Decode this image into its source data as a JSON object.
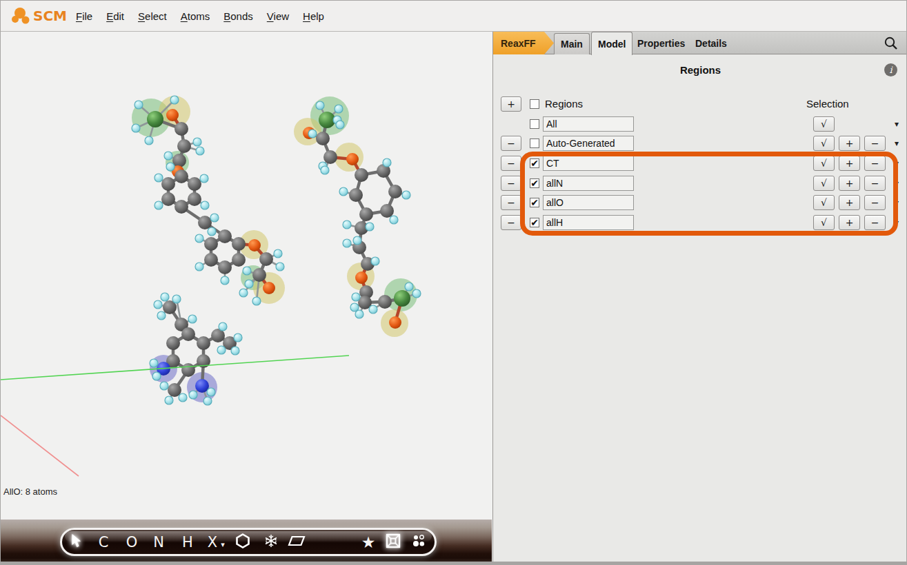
{
  "menubar": {
    "logo_text": "SCM",
    "items": [
      {
        "accel": "F",
        "rest": "ile"
      },
      {
        "accel": "E",
        "rest": "dit"
      },
      {
        "accel": "S",
        "rest": "elect"
      },
      {
        "accel": "A",
        "rest": "toms"
      },
      {
        "accel": "B",
        "rest": "onds"
      },
      {
        "accel": "V",
        "rest": "iew"
      },
      {
        "accel": "H",
        "rest": "elp"
      }
    ]
  },
  "viewport": {
    "status_text": "AllO: 8 atoms",
    "toolbar": {
      "c": "C",
      "o": "O",
      "n": "N",
      "h": "H",
      "x": "X",
      "star": "★",
      "x_arrow": "▾"
    }
  },
  "panel": {
    "tabs": {
      "reaxff": "ReaxFF",
      "main": "Main",
      "model": "Model",
      "properties": "Properties",
      "details": "Details"
    },
    "title": "Regions",
    "header": {
      "add": "+",
      "label": "Regions",
      "selection": "Selection"
    },
    "btn_check": "√",
    "btn_add": "+",
    "btn_remove": "−",
    "arrow_glyph": "▾",
    "rows": [
      {
        "name": "All",
        "check": ""
      },
      {
        "name": "Auto-Generated",
        "check": ""
      },
      {
        "name": "CT",
        "check": "✔"
      },
      {
        "name": "allN",
        "check": "✔"
      },
      {
        "name": "allO",
        "check": "✔"
      },
      {
        "name": "allH",
        "check": "✔"
      }
    ]
  },
  "scene": {
    "molecules": [
      {
        "halos": [
          [
            "g",
            218,
            125,
            28
          ],
          [
            "y",
            252,
            116,
            23
          ],
          [
            "g",
            256,
            190,
            17
          ],
          [
            "y",
            367,
            309,
            21
          ],
          [
            "g",
            366,
            357,
            18
          ],
          [
            "y",
            389,
            372,
            23
          ]
        ],
        "atoms": [
          [
            "G",
            224,
            127
          ],
          [
            "O",
            249,
            121
          ],
          [
            "C",
            262,
            141
          ],
          [
            "C",
            266,
            166
          ],
          [
            "C",
            259,
            187
          ],
          [
            "O",
            257,
            203
          ],
          [
            "C",
            262,
            210
          ],
          [
            "C",
            281,
            221
          ],
          [
            "C",
            281,
            243
          ],
          [
            "C",
            262,
            254
          ],
          [
            "C",
            243,
            243
          ],
          [
            "C",
            243,
            221
          ],
          [
            "C",
            296,
            277
          ],
          [
            "C",
            325,
            297
          ],
          [
            "C",
            345,
            308
          ],
          [
            "C",
            345,
            331
          ],
          [
            "C",
            325,
            342
          ],
          [
            "C",
            305,
            331
          ],
          [
            "C",
            305,
            308
          ],
          [
            "O",
            368,
            310
          ],
          [
            "C",
            385,
            330
          ],
          [
            "C",
            375,
            353
          ],
          [
            "O",
            389,
            372
          ],
          [
            "H",
            200,
            106
          ],
          [
            "H",
            196,
            140
          ],
          [
            "H",
            215,
            158
          ],
          [
            "H",
            252,
            99
          ],
          [
            "H",
            285,
            160
          ],
          [
            "H",
            289,
            173
          ],
          [
            "H",
            243,
            180
          ],
          [
            "H",
            246,
            196
          ],
          [
            "H",
            229,
            252
          ],
          [
            "H",
            229,
            212
          ],
          [
            "H",
            295,
            213
          ],
          [
            "H",
            296,
            252
          ],
          [
            "H",
            310,
            270
          ],
          [
            "H",
            306,
            290
          ],
          [
            "H",
            288,
            341
          ],
          [
            "H",
            325,
            361
          ],
          [
            "H",
            288,
            300
          ],
          [
            "H",
            402,
            322
          ],
          [
            "H",
            405,
            341
          ],
          [
            "H",
            357,
            347
          ],
          [
            "H",
            360,
            366
          ],
          [
            "H",
            371,
            391
          ],
          [
            "H",
            352,
            379
          ]
        ],
        "bonds": [
          [
            0,
            2
          ],
          [
            1,
            2,
            1
          ],
          [
            2,
            3
          ],
          [
            3,
            4
          ],
          [
            4,
            5,
            1
          ],
          [
            5,
            6,
            1
          ],
          [
            6,
            7
          ],
          [
            7,
            8
          ],
          [
            8,
            9
          ],
          [
            9,
            10
          ],
          [
            10,
            11
          ],
          [
            11,
            6
          ],
          [
            9,
            12
          ],
          [
            12,
            13
          ],
          [
            13,
            14
          ],
          [
            14,
            15
          ],
          [
            15,
            16
          ],
          [
            16,
            17
          ],
          [
            17,
            18
          ],
          [
            18,
            13
          ],
          [
            14,
            19,
            1
          ],
          [
            19,
            20,
            1
          ],
          [
            20,
            21
          ],
          [
            21,
            22,
            1
          ],
          [
            23,
            0
          ],
          [
            24,
            0
          ],
          [
            25,
            0
          ],
          [
            26,
            0
          ],
          [
            27,
            3
          ],
          [
            28,
            3
          ],
          [
            29,
            4
          ],
          [
            30,
            4
          ],
          [
            31,
            10
          ],
          [
            32,
            11
          ],
          [
            33,
            7
          ],
          [
            34,
            8
          ],
          [
            35,
            12
          ],
          [
            36,
            12
          ],
          [
            37,
            17
          ],
          [
            38,
            16
          ],
          [
            39,
            18
          ],
          [
            40,
            20
          ],
          [
            41,
            20
          ],
          [
            42,
            21
          ],
          [
            43,
            21
          ],
          [
            44,
            21
          ],
          [
            45,
            21
          ]
        ]
      },
      {
        "halos": [
          [
            "g",
            477,
            122,
            28
          ],
          [
            "y",
            445,
            145,
            20
          ],
          [
            "y",
            505,
            182,
            21
          ],
          [
            "y",
            522,
            355,
            20
          ],
          [
            "g",
            580,
            382,
            24
          ],
          [
            "y",
            571,
            423,
            20
          ]
        ],
        "atoms": [
          [
            "G",
            473,
            128
          ],
          [
            "O",
            447,
            147
          ],
          [
            "C",
            467,
            155
          ],
          [
            "C",
            478,
            182
          ],
          [
            "O",
            510,
            185
          ],
          [
            "C",
            523,
            208
          ],
          [
            "C",
            555,
            202
          ],
          [
            "C",
            572,
            232
          ],
          [
            "C",
            560,
            260
          ],
          [
            "C",
            530,
            265
          ],
          [
            "C",
            515,
            237
          ],
          [
            "C",
            523,
            285
          ],
          [
            "C",
            520,
            313
          ],
          [
            "C",
            532,
            337
          ],
          [
            "O",
            523,
            357
          ],
          [
            "C",
            530,
            378
          ],
          [
            "C",
            528,
            393
          ],
          [
            "C",
            557,
            392
          ],
          [
            "G",
            582,
            387
          ],
          [
            "O",
            572,
            422
          ],
          [
            "H",
            463,
            107
          ],
          [
            "H",
            488,
            128
          ],
          [
            "H",
            492,
            135
          ],
          [
            "H",
            452,
            148
          ],
          [
            "H",
            490,
            112
          ],
          [
            "H",
            467,
            195
          ],
          [
            "H",
            470,
            201
          ],
          [
            "H",
            560,
            190
          ],
          [
            "H",
            588,
            237
          ],
          [
            "H",
            497,
            232
          ],
          [
            "H",
            570,
            273
          ],
          [
            "H",
            502,
            280
          ],
          [
            "H",
            535,
            283
          ],
          [
            "H",
            502,
            307
          ],
          [
            "H",
            517,
            303
          ],
          [
            "H",
            543,
            333
          ],
          [
            "H",
            515,
            385
          ],
          [
            "H",
            513,
            400
          ],
          [
            "H",
            520,
            410
          ],
          [
            "H",
            540,
            403
          ],
          [
            "H",
            603,
            380
          ],
          [
            "H",
            592,
            370
          ]
        ],
        "bonds": [
          [
            0,
            2
          ],
          [
            1,
            2,
            1
          ],
          [
            2,
            3
          ],
          [
            3,
            4,
            1
          ],
          [
            4,
            5,
            1
          ],
          [
            5,
            6
          ],
          [
            6,
            7
          ],
          [
            7,
            8
          ],
          [
            8,
            9
          ],
          [
            9,
            10
          ],
          [
            10,
            5
          ],
          [
            9,
            11
          ],
          [
            11,
            12
          ],
          [
            12,
            13
          ],
          [
            13,
            14,
            1
          ],
          [
            14,
            15,
            1
          ],
          [
            15,
            16
          ],
          [
            16,
            17
          ],
          [
            17,
            18
          ],
          [
            18,
            19,
            1
          ],
          [
            20,
            0
          ],
          [
            21,
            0
          ],
          [
            22,
            0
          ],
          [
            23,
            2
          ],
          [
            24,
            0
          ],
          [
            25,
            3
          ],
          [
            26,
            3
          ],
          [
            27,
            6
          ],
          [
            28,
            7
          ],
          [
            29,
            10
          ],
          [
            30,
            8
          ],
          [
            31,
            11
          ],
          [
            32,
            11
          ],
          [
            33,
            12
          ],
          [
            34,
            12
          ],
          [
            35,
            13
          ],
          [
            36,
            16
          ],
          [
            37,
            16
          ],
          [
            38,
            16
          ],
          [
            39,
            17
          ],
          [
            40,
            18
          ],
          [
            41,
            18
          ]
        ]
      },
      {
        "halos": [
          [
            "b",
            236,
            489,
            20
          ],
          [
            "b",
            292,
            516,
            22
          ]
        ],
        "atoms": [
          [
            "C",
            245,
            400
          ],
          [
            "C",
            262,
            425
          ],
          [
            "C",
            272,
            439
          ],
          [
            "C",
            294,
            452
          ],
          [
            "C",
            294,
            478
          ],
          [
            "C",
            272,
            491
          ],
          [
            "C",
            250,
            478
          ],
          [
            "C",
            250,
            452
          ],
          [
            "N",
            236,
            489
          ],
          [
            "N",
            292,
            514
          ],
          [
            "C",
            315,
            441
          ],
          [
            "C",
            332,
            452
          ],
          [
            "C",
            252,
            520
          ],
          [
            "H",
            238,
            385
          ],
          [
            "H",
            228,
            396
          ],
          [
            "H",
            233,
            412
          ],
          [
            "H",
            255,
            388
          ],
          [
            "H",
            278,
            417
          ],
          [
            "H",
            222,
            481
          ],
          [
            "H",
            226,
            500
          ],
          [
            "H",
            279,
            527
          ],
          [
            "H",
            305,
            523
          ],
          [
            "H",
            300,
            536
          ],
          [
            "H",
            322,
            428
          ],
          [
            "H",
            344,
            444
          ],
          [
            "H",
            340,
            463
          ],
          [
            "H",
            320,
            462
          ],
          [
            "H",
            237,
            514
          ],
          [
            "H",
            244,
            535
          ],
          [
            "H",
            264,
            531
          ]
        ],
        "bonds": [
          [
            0,
            1
          ],
          [
            1,
            2
          ],
          [
            2,
            3
          ],
          [
            3,
            4
          ],
          [
            4,
            5
          ],
          [
            5,
            6
          ],
          [
            6,
            7
          ],
          [
            7,
            2
          ],
          [
            6,
            8
          ],
          [
            4,
            9
          ],
          [
            3,
            10
          ],
          [
            10,
            11
          ],
          [
            5,
            12
          ],
          [
            13,
            0
          ],
          [
            14,
            0
          ],
          [
            15,
            0
          ],
          [
            16,
            1
          ],
          [
            17,
            1
          ],
          [
            18,
            8
          ],
          [
            19,
            8
          ],
          [
            20,
            9
          ],
          [
            21,
            9
          ],
          [
            22,
            9
          ],
          [
            23,
            10
          ],
          [
            24,
            11
          ],
          [
            25,
            11
          ],
          [
            26,
            11
          ],
          [
            27,
            12
          ],
          [
            28,
            12
          ],
          [
            29,
            12
          ]
        ]
      }
    ],
    "axes": [
      {
        "c": "#52d452",
        "pts": [
          0,
          505,
          505,
          470
        ]
      },
      {
        "c": "#f09090",
        "pts": [
          0,
          557,
          113,
          645
        ]
      }
    ]
  }
}
